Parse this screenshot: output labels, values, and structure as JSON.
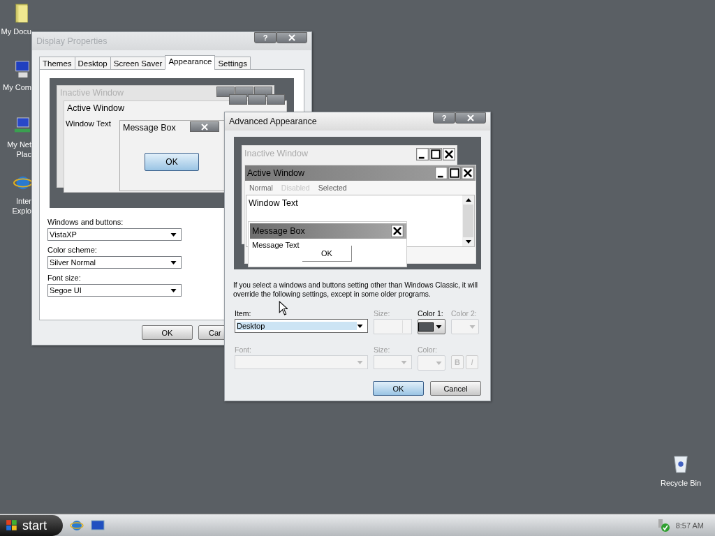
{
  "desktop_icons": [
    {
      "kind": "documents",
      "lines": [
        "My Docu"
      ]
    },
    {
      "kind": "computer",
      "lines": [
        "My Com"
      ]
    },
    {
      "kind": "network",
      "lines": [
        "My Net",
        "Plac"
      ]
    },
    {
      "kind": "browser",
      "lines": [
        "Inter",
        "Explo"
      ]
    }
  ],
  "recycle_bin": {
    "label": "Recycle Bin"
  },
  "display_properties": {
    "title": "Display Properties",
    "active": false,
    "help": "?",
    "tabs": [
      {
        "label": "Themes",
        "selected": false
      },
      {
        "label": "Desktop",
        "selected": false
      },
      {
        "label": "Screen Saver",
        "selected": false
      },
      {
        "label": "Appearance",
        "selected": true
      },
      {
        "label": "Settings",
        "selected": false
      }
    ],
    "preview": {
      "inactive_title": "Inactive Window",
      "active_title": "Active Window",
      "window_text": "Window Text",
      "message_box_title": "Message Box",
      "ok": "OK"
    },
    "fields": [
      {
        "label": "Windows and buttons:",
        "value": "VistaXP"
      },
      {
        "label": "Color scheme:",
        "value": "Silver Normal"
      },
      {
        "label": "Font size:",
        "value": "Segoe UI"
      }
    ],
    "buttons": [
      {
        "label": "OK",
        "default": false
      },
      {
        "label": "Car",
        "default": false
      }
    ]
  },
  "advanced_appearance": {
    "title": "Advanced Appearance",
    "active": true,
    "help": "?",
    "preview": {
      "inactive_title": "Inactive Window",
      "active_title": "Active Window",
      "menu": [
        {
          "label": "Normal",
          "kind": "normal"
        },
        {
          "label": "Disabled",
          "kind": "disabled"
        },
        {
          "label": "Selected",
          "kind": "selected"
        }
      ],
      "window_text": "Window Text",
      "message_box_title": "Message Box",
      "message_text": "Message Text",
      "ok": "OK"
    },
    "description": "If you select a windows and buttons setting other than Windows Classic, it will override the following settings, except in some older programs.",
    "item": {
      "label": "Item:",
      "value": "Desktop",
      "disabled": false
    },
    "item_size": {
      "label": "Size:",
      "disabled": true
    },
    "color_1": {
      "label": "Color 1:",
      "disabled": false,
      "color": "#505458"
    },
    "color_2": {
      "label": "Color 2:",
      "disabled": true
    },
    "font": {
      "label": "Font:",
      "disabled": true
    },
    "font_size": {
      "label": "Size:",
      "disabled": true
    },
    "font_color": {
      "label": "Color:",
      "disabled": true
    },
    "bold": {
      "label": "B",
      "disabled": true
    },
    "italic": {
      "label": "I",
      "disabled": true
    },
    "buttons": [
      {
        "label": "OK",
        "default": true
      },
      {
        "label": "Cancel",
        "default": false
      }
    ]
  },
  "taskbar": {
    "start": "start",
    "clock": "8:57 AM"
  }
}
